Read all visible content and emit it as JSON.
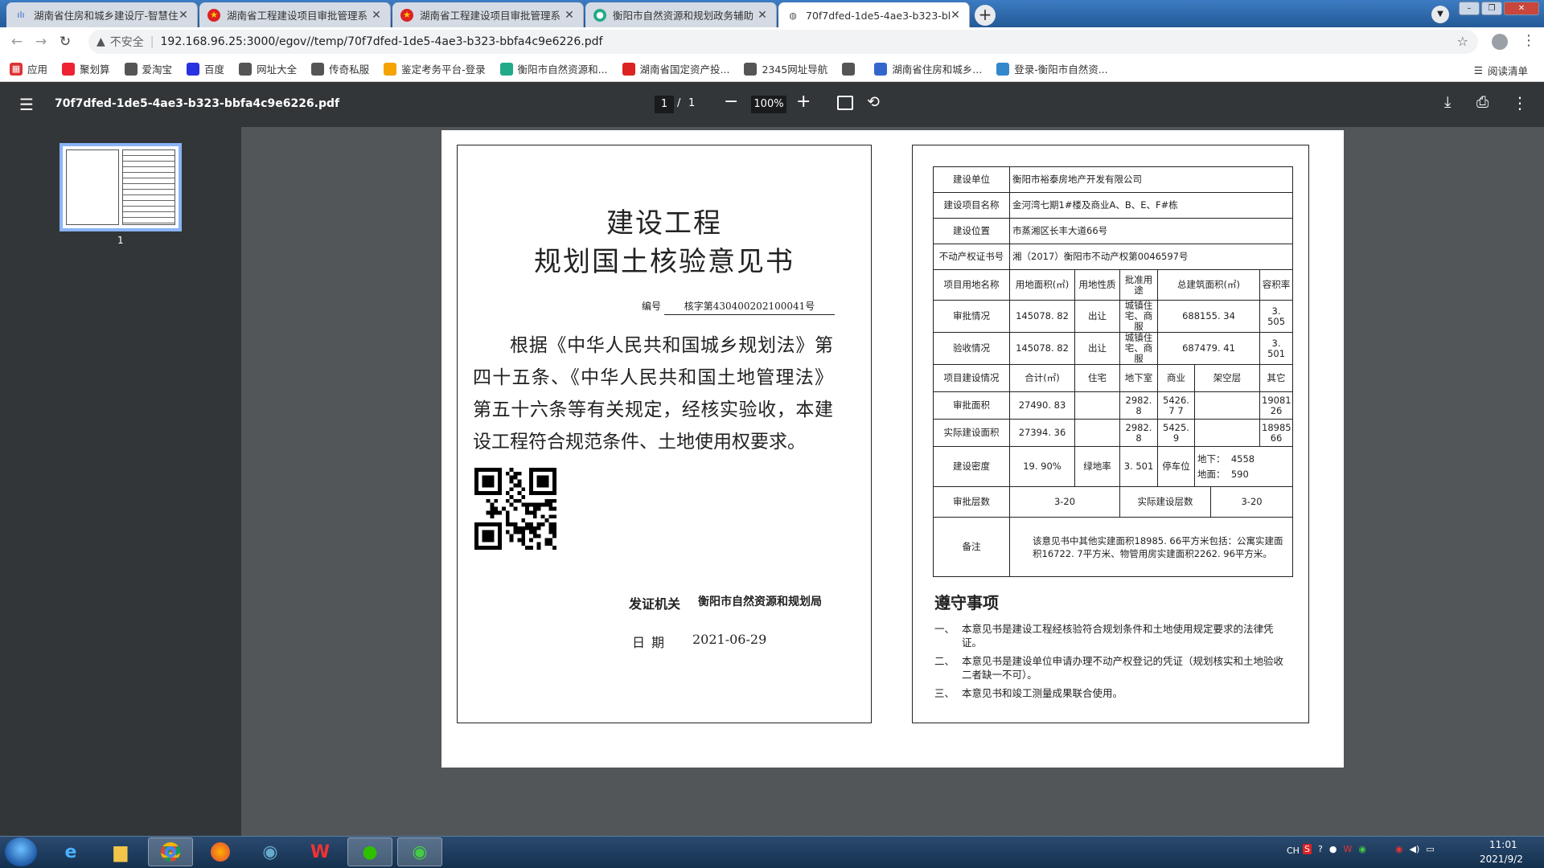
{
  "tabs": [
    {
      "title": "湖南省住房和城乡建设厅-智慧住",
      "icon": "housing-dept-icon"
    },
    {
      "title": "湖南省工程建设项目审批管理系",
      "icon": "emblem-icon"
    },
    {
      "title": "湖南省工程建设项目审批管理系",
      "icon": "emblem-icon"
    },
    {
      "title": "衡阳市自然资源和规划政务辅助",
      "icon": "resources-bureau-icon"
    },
    {
      "title": "70f7dfed-1de5-4ae3-b323-bb",
      "icon": "globe-icon"
    }
  ],
  "address": {
    "insecure_label": "不安全",
    "url": "192.168.96.25:3000/egov//temp/70f7dfed-1de5-4ae3-b323-bbfa4c9e6226.pdf"
  },
  "bookmarks": [
    {
      "label": "应用",
      "color": "#d33"
    },
    {
      "label": "聚划算",
      "color": "#e23"
    },
    {
      "label": "爱淘宝",
      "color": "#555"
    },
    {
      "label": "百度",
      "color": "#2932e1"
    },
    {
      "label": "网址大全",
      "color": "#555"
    },
    {
      "label": "传奇私服",
      "color": "#555"
    },
    {
      "label": "鉴定考务平台-登录",
      "color": "#f4a300"
    },
    {
      "label": "衡阳市自然资源和...",
      "color": "#2a8"
    },
    {
      "label": "湖南省国定资产投...",
      "color": "#d22"
    },
    {
      "label": "2345网址导航",
      "color": "#555"
    },
    {
      "label": "",
      "color": "#555"
    },
    {
      "label": "湖南省住房和城乡...",
      "color": "#36c"
    },
    {
      "label": "登录-衡阳市自然资...",
      "color": "#38c"
    }
  ],
  "reading_list": "阅读清单",
  "pdf": {
    "filename": "70f7dfed-1de5-4ae3-b323-bbfa4c9e6226.pdf",
    "page_current": "1",
    "page_sep": "/",
    "page_total": "1",
    "zoom": "100%",
    "thumb_label": "1"
  },
  "doc": {
    "title1": "建设工程",
    "title2": "规划国土核验意见书",
    "num_label": "编号",
    "num_value": "核字第430400202100041号",
    "body": "根据《中华人民共和国城乡规划法》第四十五条、《中华人民共和国土地管理法》第五十六条等有关规定，经核实验收，本建设工程符合规范条件、土地使用权要求。",
    "issuer_label": "发证机关",
    "issuer_value": "衡阳市自然资源和规划局",
    "date_label": "日期",
    "date_value": "2021-06-29"
  },
  "table": {
    "unit_label": "建设单位",
    "unit": "衡阳市裕泰房地产开发有限公司",
    "project_label": "建设项目名称",
    "project": "金河湾七期1#楼及商业A、B、E、F#栋",
    "location_label": "建设位置",
    "location": "市蒸湘区长丰大道66号",
    "cert_label": "不动产权证书号",
    "cert": "湘（2017）衡阳市不动产权第0046597号",
    "land_header": [
      "项目用地名称",
      "用地面积(㎡)",
      "用地性质",
      "批准用途",
      "总建筑面积(㎡)",
      "容积率"
    ],
    "approval_row": [
      "审批情况",
      "145078. 82",
      "出让",
      "城镇住宅、商服",
      "688155. 34",
      "3. 505"
    ],
    "acceptance_row": [
      "验收情况",
      "145078. 82",
      "出让",
      "城镇住宅、商服",
      "687479. 41",
      "3. 501"
    ],
    "build_header": [
      "项目建设情况",
      "合计(㎡)",
      "住宅",
      "地下室",
      "商业",
      "架空层",
      "其它"
    ],
    "approved_area_row": [
      "审批面积",
      "27490. 83",
      "",
      "2982. 8",
      "5426. 7 7",
      "",
      "19081. 26"
    ],
    "actual_area_row": [
      "实际建设面积",
      "27394. 36",
      "",
      "2982. 8",
      "5425. 9",
      "",
      "18985. 66"
    ],
    "density_label": "建设密度",
    "density": "19. 90%",
    "green_label": "绿地率",
    "green": "3. 501",
    "parking_label": "停车位",
    "parking_under_label": "地下：",
    "parking_under": "4558",
    "parking_ground_label": "地面：",
    "parking_ground": "590",
    "floors_label": "审批层数",
    "floors": "3-20",
    "actual_floors_label": "实际建设层数",
    "actual_floors": "3-20",
    "remark_label": "备注",
    "remark": "该意见书中其他实建面积18985. 66平方米包括：公寓实建面积16722. 7平方米、物管用房实建面积2262. 96平方米。"
  },
  "rules": {
    "title": "遵守事项",
    "items": [
      {
        "n": "一、",
        "text": "本意见书是建设工程经核验符合规划条件和土地使用规定要求的法律凭证。"
      },
      {
        "n": "二、",
        "text": "本意见书是建设单位申请办理不动产权登记的凭证（规划核实和土地验收二者缺一不可）。"
      },
      {
        "n": "三、",
        "text": "本意见书和竣工测量成果联合使用。"
      }
    ]
  },
  "taskbar": {
    "lang": "CH",
    "time": "11:01",
    "date": "2021/9/2"
  }
}
